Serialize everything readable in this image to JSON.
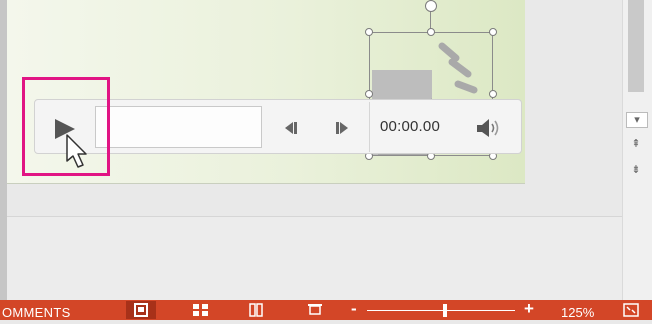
{
  "player": {
    "time": "00:00.00",
    "play_icon": "play-icon",
    "back_icon": "skip-back-icon",
    "forward_icon": "skip-forward-icon",
    "volume_icon": "volume-icon"
  },
  "audio_object": {
    "icon": "speaker-icon"
  },
  "scrollbar": {
    "dropdown_icon": "chevron-down-icon",
    "prev_slide_icon": "double-chevron-up-icon",
    "next_slide_icon": "double-chevron-down-icon"
  },
  "status_bar": {
    "label": "OMMENTS",
    "zoom_level": "125%",
    "zoom_minus": "-",
    "zoom_plus": "+",
    "zoom_fraction": 0.53,
    "views": [
      "normal-view-icon",
      "slide-sorter-icon",
      "reading-view-icon",
      "slide-show-icon"
    ],
    "fit_icon": "fit-to-window-icon"
  },
  "colors": {
    "status_bar": "#d34627",
    "highlight": "#e11484",
    "slide_bg": "#eaf1db"
  }
}
